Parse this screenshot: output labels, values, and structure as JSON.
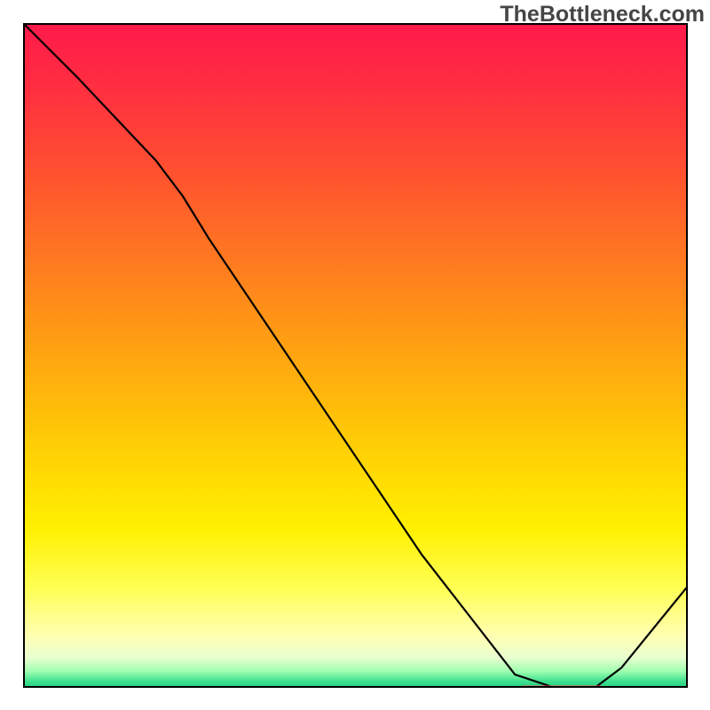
{
  "watermark": "TheBottleneck.com",
  "chart_data": {
    "type": "line",
    "title": "",
    "xlabel": "",
    "ylabel": "",
    "xlim": [
      0,
      100
    ],
    "ylim": [
      0,
      100
    ],
    "series": [
      {
        "name": "curve",
        "x": [
          0.0,
          8.0,
          20.0,
          24.0,
          28.0,
          60.0,
          74.0,
          80.0,
          86.0,
          90.0,
          100.0
        ],
        "values": [
          100.0,
          92.0,
          79.3,
          74.0,
          67.5,
          20.0,
          2.0,
          0.0,
          0.0,
          3.0,
          15.3
        ]
      }
    ],
    "marker": {
      "name": "flat-marker",
      "y": 0.0,
      "x_start": 75.0,
      "x_end": 87.0,
      "color": "#ff4b4b"
    },
    "background_gradient": [
      {
        "offset": 0.0,
        "color": "#ff1a4b"
      },
      {
        "offset": 0.1,
        "color": "#ff2f40"
      },
      {
        "offset": 0.22,
        "color": "#ff5030"
      },
      {
        "offset": 0.36,
        "color": "#ff7a20"
      },
      {
        "offset": 0.5,
        "color": "#ffa510"
      },
      {
        "offset": 0.64,
        "color": "#ffcf05"
      },
      {
        "offset": 0.76,
        "color": "#fff000"
      },
      {
        "offset": 0.85,
        "color": "#ffff55"
      },
      {
        "offset": 0.92,
        "color": "#ffffb0"
      },
      {
        "offset": 0.955,
        "color": "#e9ffd0"
      },
      {
        "offset": 0.975,
        "color": "#a0ffb0"
      },
      {
        "offset": 0.99,
        "color": "#40e090"
      },
      {
        "offset": 1.0,
        "color": "#20d080"
      }
    ]
  }
}
